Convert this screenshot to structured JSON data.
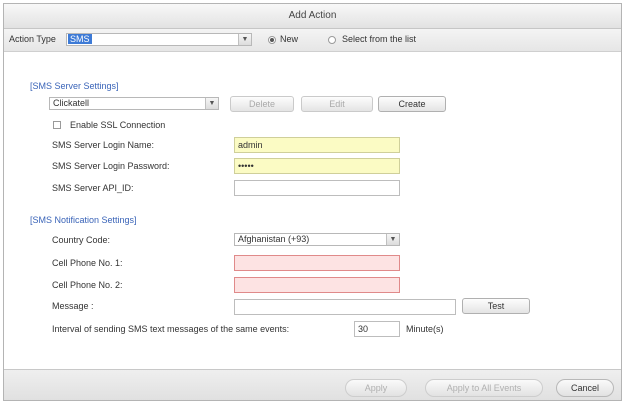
{
  "dialog": {
    "title": "Add Action"
  },
  "toolbar": {
    "action_type_label": "Action Type",
    "action_type_value": "SMS",
    "radio_new_label": "New",
    "radio_select_label": "Select from the list"
  },
  "sms_server": {
    "section_title": "[SMS Server Settings]",
    "provider_value": "Clickatell",
    "buttons": {
      "delete": "Delete",
      "edit": "Edit",
      "create": "Create"
    },
    "ssl_label": "Enable SSL Connection",
    "login_name_label": "SMS Server Login Name:",
    "login_name_value": "admin",
    "login_password_label": "SMS Server Login Password:",
    "login_password_value": "•••••",
    "api_id_label": "SMS Server API_ID:",
    "api_id_value": ""
  },
  "sms_notification": {
    "section_title": "[SMS Notification Settings]",
    "country_label": "Country Code:",
    "country_value": "Afghanistan (+93)",
    "cell1_label": "Cell Phone No. 1:",
    "cell1_value": "",
    "cell2_label": "Cell Phone No. 2:",
    "cell2_value": "",
    "message_label": "Message :",
    "message_value": "",
    "test_button": "Test",
    "interval_label": "Interval of sending SMS text messages of the same events:",
    "interval_value": "30",
    "interval_unit": "Minute(s)"
  },
  "footer": {
    "apply": "Apply",
    "apply_all": "Apply to All Events",
    "cancel": "Cancel"
  },
  "colors": {
    "section_title": "#3a64b8",
    "required_field": "#fbfbc4",
    "error_field": "#fde3e3",
    "selection": "#3d7ad6"
  }
}
